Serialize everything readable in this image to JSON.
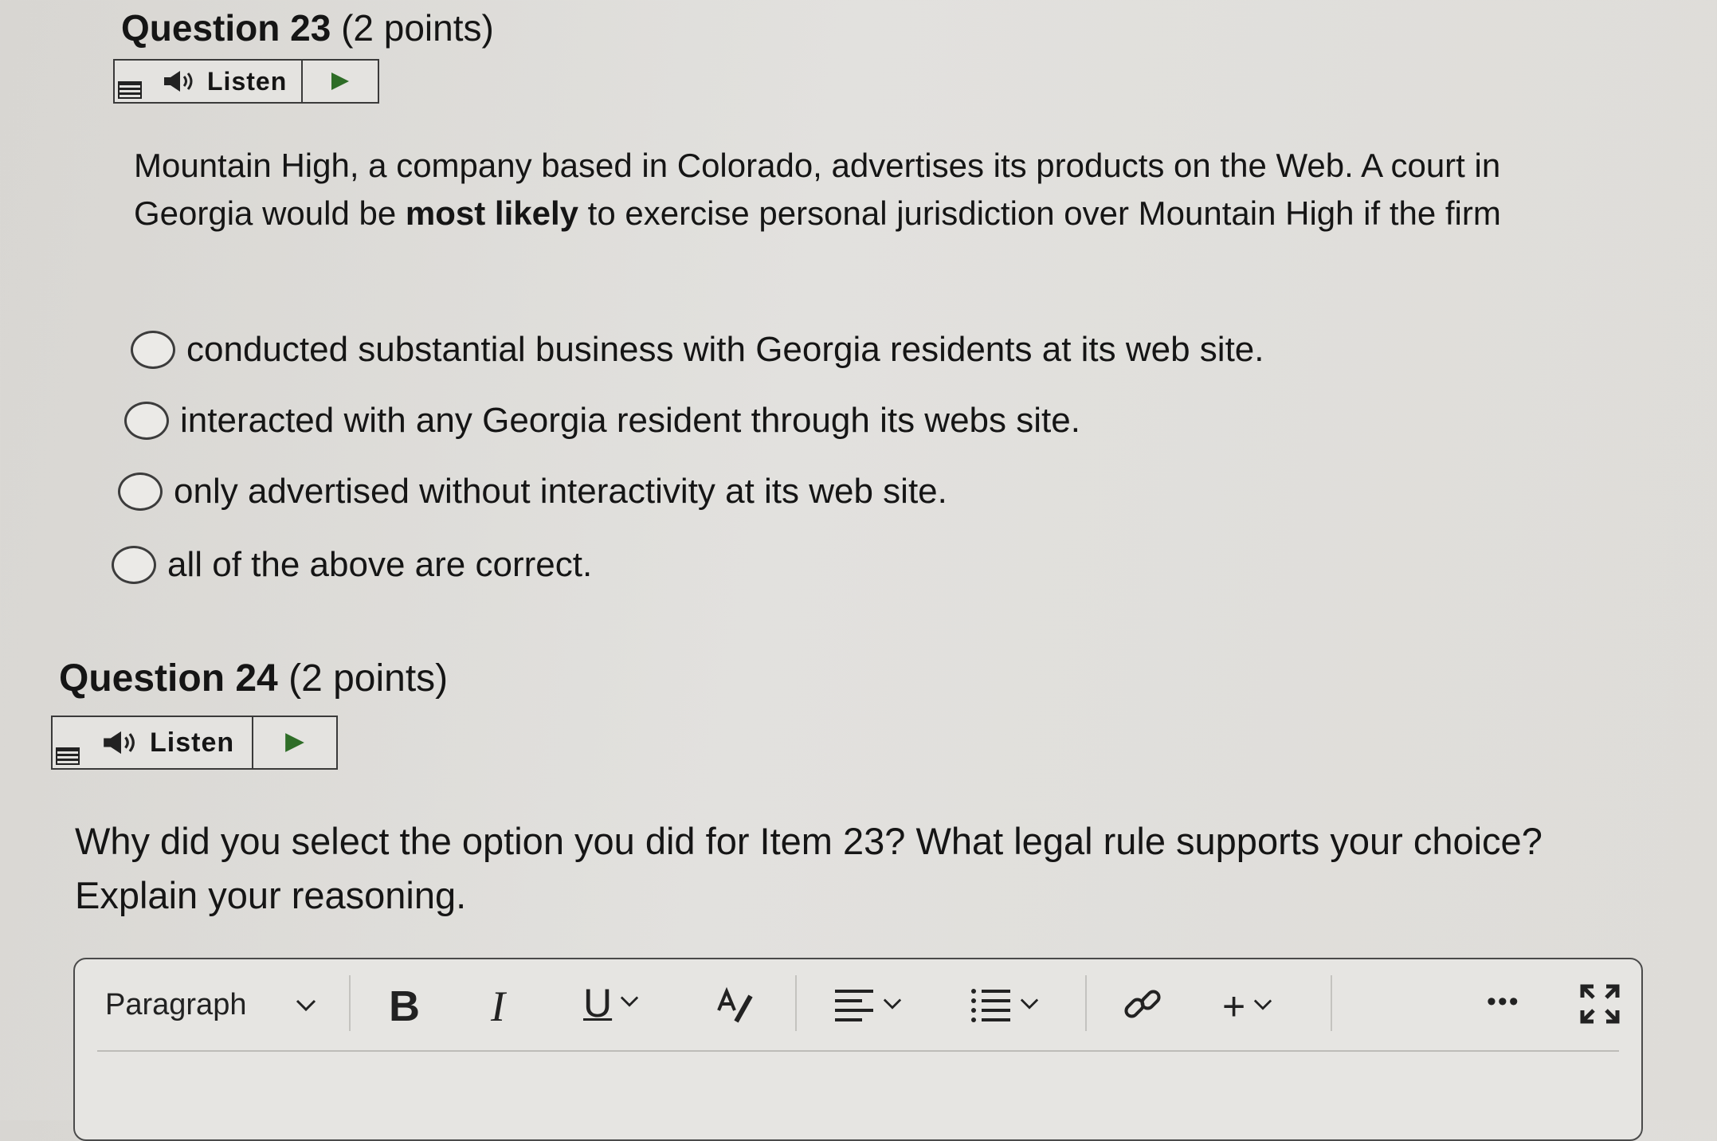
{
  "q23": {
    "title": "Question 23",
    "points": "(2 points)",
    "listen_label": "Listen",
    "prompt_part1": "Mountain High, a company based in Colorado, advertises its products on the Web. A court in Georgia would be ",
    "prompt_bold": "most likely",
    "prompt_part2": " to exercise personal jurisdiction over Mountain High if the firm",
    "options": [
      "conducted substantial business with Georgia residents at its web site.",
      "interacted with any Georgia resident through its webs site.",
      "only advertised without interactivity at its web site.",
      "all of the above are correct."
    ]
  },
  "q24": {
    "title": "Question 24",
    "points": "(2 points)",
    "listen_label": "Listen",
    "prompt": "Why did you select the option you did for Item 23? What legal rule supports your choice? Explain your reasoning."
  },
  "editor": {
    "block_format": "Paragraph",
    "bold_label": "B",
    "italic_label": "I",
    "underline_label": "U",
    "more_label": "•••",
    "insert_label": "+"
  }
}
